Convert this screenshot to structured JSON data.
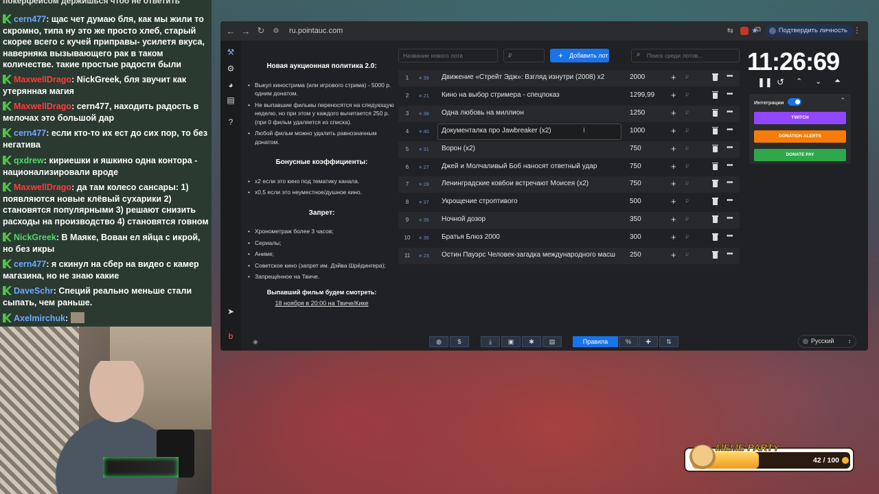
{
  "chat": {
    "clipped_text": "покерфейсом держишься чтоб не ответить",
    "messages": [
      {
        "user": "cern477",
        "color": "#6fa8ff",
        "text": "щас чет думаю бля, как мы жили то скромно, типа ну это же просто хлеб, старый скорее всего с кучей приправы- усилетя вкуса, наверняка вызывающего рак в таком количестве. такие простые радости были"
      },
      {
        "user": "MaxwellDrago",
        "color": "#ff3b3b",
        "text": "NickGreek, бля звучит как утерянная магия"
      },
      {
        "user": "MaxwellDrago",
        "color": "#ff3b3b",
        "text": "cern477, находить радость в мелочах это большой дар"
      },
      {
        "user": "cern477",
        "color": "#6fa8ff",
        "text": "если кто-то их ест до сих пор, то без негатива"
      },
      {
        "user": "qxdrew",
        "color": "#4fd86a",
        "text": "кириешки и яшкино одна контора - национализировали вроде"
      },
      {
        "user": "MaxwellDrago",
        "color": "#ff3b3b",
        "text": "да там колесо сансары: 1) появляются новые клёвый сухарики 2) становятся популярными 3) решают снизить расходы на производство 4) становятся говном"
      },
      {
        "user": "NickGreek",
        "color": "#4fd86a",
        "text": "В Маяке, Вован ел яйца с икрой, но без икры"
      },
      {
        "user": "cern477",
        "color": "#6fa8ff",
        "text": "я скинул на сбер на видео с камер магазина, но не знаю какие"
      },
      {
        "user": "DaveSchr",
        "color": "#6fa8ff",
        "text": "Специй реально меньше стали сыпать, чем раньше."
      },
      {
        "user": "Axelmirchuk",
        "color": "#6fa8ff",
        "text": ""
      }
    ]
  },
  "browser": {
    "url": "ru.pointauc.com",
    "verify": "Подтвердить личность"
  },
  "rules": {
    "title": "Новая аукционная политика 2.0:",
    "policy": [
      "Выкуп киностримa (или игрового стрима) - 5000 р. одним донатом.",
      "Не выпавшие фильмы переносятся на следующую неделю, но при этом у каждого вычитается 250 р. (при 0 фильм удаляется из списка).",
      "Любой фильм можно удалить равнозначным донатом."
    ],
    "bonus_title": "Бонусные коэффициенты:",
    "bonus": [
      "x2 если это кино под тематику канала.",
      "x0,5 если это неуместное/душное кино."
    ],
    "ban_title": "Запрет:",
    "ban": [
      "Хронометраж более 3 часов;",
      "Сериалы;",
      "Аниме;",
      "Советское кино (запрет им. Дэйва Шрёдингера);",
      "Запрещённое на Твиче."
    ],
    "watch_title": "Выпавший фильм будем смотреть:",
    "watch_link": "18 ноября в 20:00 на Твиче/Кике"
  },
  "controls": {
    "lot_name_placeholder": "Название нового лота",
    "amount_placeholder": "₽",
    "add_button": "Добавить лот",
    "search_placeholder": "Поиск среди лотов..."
  },
  "lots": [
    {
      "n": "1",
      "id": "39",
      "name": "Движение «Стрейт Эдж»: Взгляд изнутри (2008) x2",
      "amount": "2000"
    },
    {
      "n": "2",
      "id": "21",
      "name": "Кино на выбор стримера - спецпоказ",
      "amount": "1299,99"
    },
    {
      "n": "3",
      "id": "38",
      "name": "Одна любовь на миллион",
      "amount": "1250"
    },
    {
      "n": "4",
      "id": "40",
      "name": "Документалка про Jawbreaker (x2)",
      "amount": "1000"
    },
    {
      "n": "5",
      "id": "31",
      "name": "Ворон (x2)",
      "amount": "750"
    },
    {
      "n": "6",
      "id": "27",
      "name": "Джей и Молчаливый Боб наносят ответный удар",
      "amount": "750"
    },
    {
      "n": "7",
      "id": "28",
      "name": "Ленинградские ковбои встречают Моисея (x2)",
      "amount": "750"
    },
    {
      "n": "8",
      "id": "37",
      "name": "Укрощение строптивого",
      "amount": "500"
    },
    {
      "n": "9",
      "id": "35",
      "name": "Ночной дозор",
      "amount": "350"
    },
    {
      "n": "10",
      "id": "36",
      "name": "Братья Блюз 2000",
      "amount": "300"
    },
    {
      "n": "11",
      "id": "23",
      "name": "Остин Пауэрс Человек-загадка международного масш",
      "amount": "250"
    }
  ],
  "timer": {
    "display": "11:26:69"
  },
  "integrations": {
    "label": "Интеграции",
    "buttons": [
      {
        "label": "TWITCH",
        "color": "#9146ff"
      },
      {
        "label": "DONATION ALERTS",
        "color": "#f57d07"
      },
      {
        "label": "DONATE PAY",
        "color": "#2fa84a"
      }
    ]
  },
  "bottom": {
    "rules_label": "Правила",
    "lang": "Русский"
  },
  "meme": {
    "title": "MEME-PARTY",
    "count": "42 / 100",
    "progress": 0.42
  }
}
